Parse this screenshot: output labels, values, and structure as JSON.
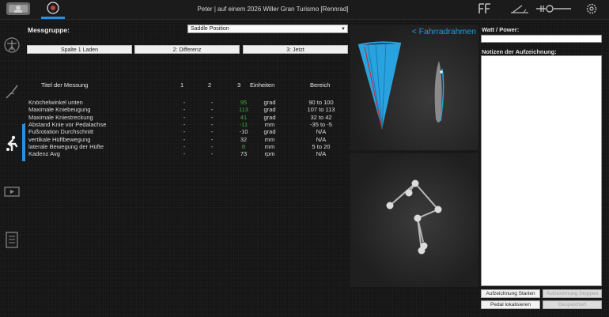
{
  "window": {
    "title": "Peter | auf einem 2026 Willer Gran Turismo [Rennrad]"
  },
  "topbar": {
    "left_icons": [
      "profile-icon",
      "bike-icon"
    ],
    "right_icons": [
      "fit-logo-icon",
      "angle-tool-icon",
      "adjust-slider-icon",
      "settings-icon"
    ]
  },
  "nav": {
    "icons": [
      "body-icon",
      "leg-angle-icon",
      "cyclist-icon",
      "video-icon",
      "report-icon"
    ],
    "active": "cyclist-icon"
  },
  "measurement_group": {
    "label": "Messgruppe:",
    "selected": "Saddle Position"
  },
  "column_buttons": {
    "load": "Spalte 1 Laden",
    "diff": "2: Differenz",
    "now": "3: Jetzt"
  },
  "table": {
    "headers": {
      "name": "Titel der Messung",
      "c1": "1",
      "c2": "2",
      "c3": "3",
      "unit": "Einheiten",
      "range": "Bereich"
    },
    "rows": [
      {
        "name": "Knöchelwinkel unten",
        "c1": "-",
        "c2": "-",
        "c3": "95",
        "unit": "grad",
        "range": "90 to 100",
        "green": true
      },
      {
        "name": "Maximale Kniebeugung",
        "c1": "-",
        "c2": "-",
        "c3": "113",
        "unit": "grad",
        "range": "107 to 113",
        "green": true
      },
      {
        "name": "Maximale Kniestreckung",
        "c1": "-",
        "c2": "-",
        "c3": "41",
        "unit": "grad",
        "range": "32 to 42",
        "green": true
      },
      {
        "name": "Abstand Knie vor Pedalachse",
        "c1": "-",
        "c2": "-",
        "c3": "-11",
        "unit": "mm",
        "range": "-35 to -5",
        "green": true
      },
      {
        "name": "Fußrotation Durchschnitt",
        "c1": "-",
        "c2": "-",
        "c3": "-10",
        "unit": "grad",
        "range": "N/A",
        "green": false
      },
      {
        "name": "vertikale Hüftbewegung",
        "c1": "-",
        "c2": "-",
        "c3": "32",
        "unit": "mm",
        "range": "N/A",
        "green": false
      },
      {
        "name": "laterale Bewegung der Hüfte",
        "c1": "-",
        "c2": "-",
        "c3": "8",
        "unit": "mm",
        "range": "5 to 20",
        "green": true
      },
      {
        "name": "Kadenz Avg",
        "c1": "-",
        "c2": "-",
        "c3": "73",
        "unit": "rpm",
        "range": "N/A",
        "green": false
      }
    ]
  },
  "frame_panel": {
    "link": "< Fahrradrahmen"
  },
  "right": {
    "watt_label": "Watt / Power:",
    "watt_value": "",
    "notes_label": "Notizen der Aufzeichnung:",
    "notes_value": "",
    "start_button": "Aufzeichnung Starten",
    "stop_button": "Aufzeichnung Stoppen",
    "pedal_button": "Pedal lokalisieren",
    "saved_button": "Gespeichert"
  },
  "colors": {
    "accent": "#1e9be4",
    "in_range": "#3fae3f",
    "fan": "#29a3e0",
    "fan_line": "#c0303a"
  }
}
